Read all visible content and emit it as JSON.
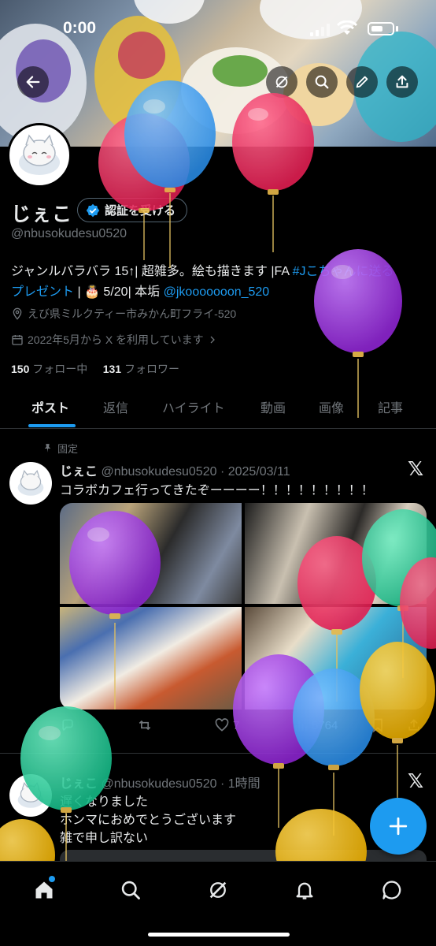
{
  "status_bar": {
    "time": "0:00"
  },
  "profile": {
    "display_name": "じぇこ",
    "verify_label": "認証を受ける",
    "handle": "@nbusokudesu0520",
    "bio_line1_a": "ジャンルバラバラ 15↑| 超雑多。絵も描きます |FA ",
    "bio_line1_link": "#Jこちゃんに送る",
    "bio_line2_link": "プレゼント",
    "bio_line2_a": " | 🎂 5/20| 本垢 ",
    "bio_line2_mention": "@jkooooooon_520",
    "location": "えび県ミルクティー市みかん町フライ-520",
    "joined": "2022年5月から X を利用しています",
    "following_count": "150",
    "following_label": "フォロー中",
    "followers_count": "131",
    "followers_label": "フォロワー"
  },
  "tabs": [
    {
      "label": "ポスト",
      "active": true
    },
    {
      "label": "返信",
      "active": false
    },
    {
      "label": "ハイライト",
      "active": false
    },
    {
      "label": "動画",
      "active": false
    },
    {
      "label": "画像",
      "active": false
    },
    {
      "label": "記事",
      "active": false
    }
  ],
  "pinned_post": {
    "pinned_label": "固定",
    "name": "じぇこ",
    "meta": "@nbusokudesu0520 · 2025/03/11",
    "text": "コラボカフェ行ってきたぞーーーー！！！！！！！！！",
    "like_count": "7",
    "view_count": "5764"
  },
  "second_post": {
    "name": "じぇこ",
    "meta": "@nbusokudesu0520 · 1時間",
    "lines": [
      "遅くなりました",
      "ホンマにおめでとうございます",
      "雑で申し訳ない"
    ]
  },
  "icons": {
    "back": "back-arrow-icon",
    "grok": "grok-icon",
    "search": "search-icon",
    "edit": "pencil-icon",
    "share": "share-icon",
    "x_logo": "x-logo-icon",
    "location": "location-icon",
    "calendar": "calendar-icon",
    "pin": "pin-icon"
  },
  "colors": {
    "accent": "#1d9bf0",
    "background": "#000000",
    "muted": "#71767b",
    "text": "#e7e9ea"
  }
}
